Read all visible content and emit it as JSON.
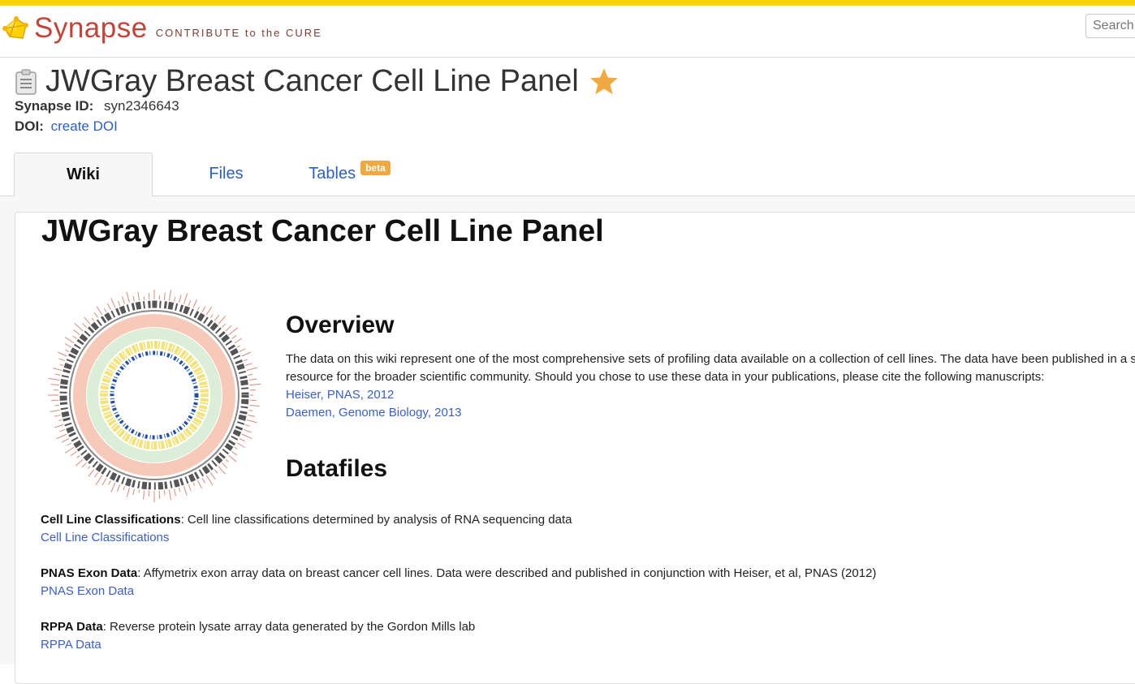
{
  "header": {
    "logo_word": "Synapse",
    "logo_tagline": "CONTRIBUTE to the CURE",
    "search_placeholder": "Search"
  },
  "entity": {
    "title": "JWGray Breast Cancer Cell Line Panel",
    "synapse_id_label": "Synapse ID:",
    "synapse_id": "syn2346643",
    "doi_label": "DOI:",
    "doi_link": "create DOI"
  },
  "tabs": [
    {
      "label": "Wiki"
    },
    {
      "label": "Files"
    },
    {
      "label": "Tables",
      "badge": "beta"
    }
  ],
  "wiki": {
    "title": "JWGray Breast Cancer Cell Line Panel",
    "overview_heading": "Overview",
    "overview_text": "The data on this wiki represent one of the most comprehensive sets of profiling data available on a collection of cell lines. The data have been published in a single resource for the broader scientific community. Should you chose to use these data in your publications, please cite the following manuscripts:",
    "citations": [
      "Heiser, PNAS, 2012",
      "Daemen, Genome Biology, 2013"
    ],
    "datafiles_heading": "Datafiles",
    "datafiles": [
      {
        "name": "Cell Line Classifications",
        "desc": ": Cell line classifications determined by analysis of RNA sequencing data",
        "link": "Cell Line Classifications"
      },
      {
        "name": "PNAS Exon Data",
        "desc": ": Affymetrix exon array data on breast cancer cell lines. Data were described and published in conjunction with Heiser, et al, PNAS (2012)",
        "link": "PNAS Exon Data"
      },
      {
        "name": "RPPA Data",
        "desc": ": Reverse protein lysate array data generated by the Gordon Mills lab",
        "link": "RPPA Data"
      }
    ]
  },
  "colors": {
    "accent_bar": "#ffd200",
    "link": "#2d5fbf",
    "logo_red": "#c0463c",
    "star": "#f0a940"
  }
}
